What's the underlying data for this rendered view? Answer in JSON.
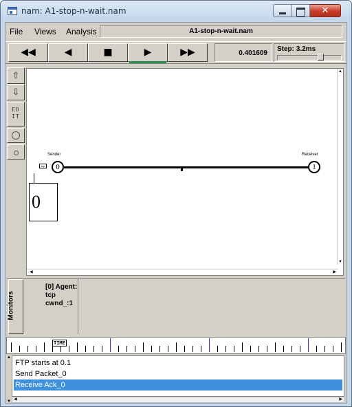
{
  "window": {
    "title": "nam: A1-stop-n-wait.nam",
    "close_glyph": "✕"
  },
  "menu": {
    "file": "File",
    "views": "Views",
    "analysis": "Analysis"
  },
  "filename": "A1-stop-n-wait.nam",
  "controls": {
    "rewind": "◀◀",
    "back": "◀",
    "stop": "■",
    "play": "▶",
    "ffwd": "▶▶",
    "time": "0.401609",
    "step": "Step: 3.2ms"
  },
  "tools": {
    "zoom_in_icon": "zoom-in-icon",
    "zoom_out_icon": "zoom-out-icon",
    "edit": "ED IT"
  },
  "network": {
    "sender_label": "Sender",
    "receiver_label": "Receiver",
    "sender_id": "0",
    "receiver_id": "1",
    "cwnd_value": "0"
  },
  "monitors": {
    "label": "Monitors",
    "text_line1": "[0] Agent: tcp",
    "text_line2": "cwnd_:1"
  },
  "timeline": {
    "marker": "TIME"
  },
  "annotations": {
    "items": [
      "FTP starts at 0.1",
      "Send Packet_0",
      "Receive Ack_0"
    ],
    "selected_index": 2
  },
  "colors": {
    "selection": "#3f91dd",
    "play_indicator": "#2f8a4d",
    "timeline_blue": "#3b3bd0"
  }
}
